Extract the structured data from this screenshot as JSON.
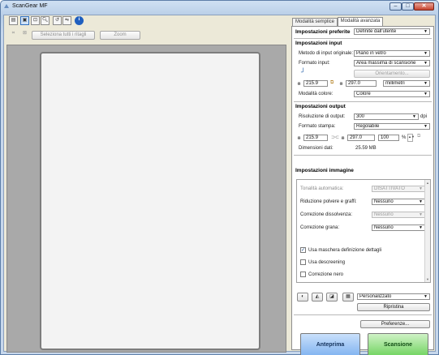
{
  "window": {
    "title": "ScanGear MF"
  },
  "left": {
    "crop_button": "Seleziona tutti i ritagli",
    "zoom_button": "Zoom"
  },
  "tabs": {
    "basic": "Modalità semplice",
    "advanced": "Modalità avanzata"
  },
  "preferences": {
    "label": "Impostazioni preferite",
    "value": "Definite dall'utente"
  },
  "input": {
    "section_title": "Impostazioni input",
    "method_label": "Metodo di input originale:",
    "method_value": "Piano in vetro",
    "format_label": "Formato input:",
    "format_value": "Area massima di scansione",
    "orientation_button": "Orientamento...",
    "width": "215.9",
    "height": "297.0",
    "unit": "millimetri",
    "color_label": "Modalità colore:",
    "color_value": "Colore"
  },
  "output": {
    "section_title": "Impostazioni output",
    "resolution_label": "Risoluzione di output:",
    "resolution_value": "300",
    "resolution_unit": "dpi",
    "print_label": "Formato stampa:",
    "print_value": "Regolabile",
    "width": "215.9",
    "height": "297.0",
    "scale": "100",
    "scale_unit": "%",
    "size_label": "Dimensioni dati:",
    "size_value": "25.59 MB"
  },
  "image": {
    "section_title": "Impostazioni immagine",
    "auto_tone_label": "Tonalità automatica:",
    "auto_tone_value": "DISATTIVATO",
    "dust_label": "Riduzione polvere e graffi:",
    "dust_value": "Nessuno",
    "fade_label": "Correzione dissolvenza:",
    "fade_value": "Nessuno",
    "grain_label": "Correzione grana:",
    "grain_value": "Nessuno",
    "unsharp_label": "Usa maschera definizione dettagli",
    "unsharp_checked": true,
    "descreen_label": "Usa descreening",
    "descreen_checked": false,
    "black_label": "Correzione nero",
    "black_checked": false
  },
  "adjust": {
    "preset_value": "Personalizzato",
    "restore_button": "Ripristina"
  },
  "preferences_button": "Preferenze...",
  "actions": {
    "preview": "Anteprima",
    "scan": "Scansione"
  },
  "colors": {
    "preview_button": "#7fb2f0",
    "scan_button": "#6fd35e",
    "titlebar": "#cfe0f3"
  }
}
